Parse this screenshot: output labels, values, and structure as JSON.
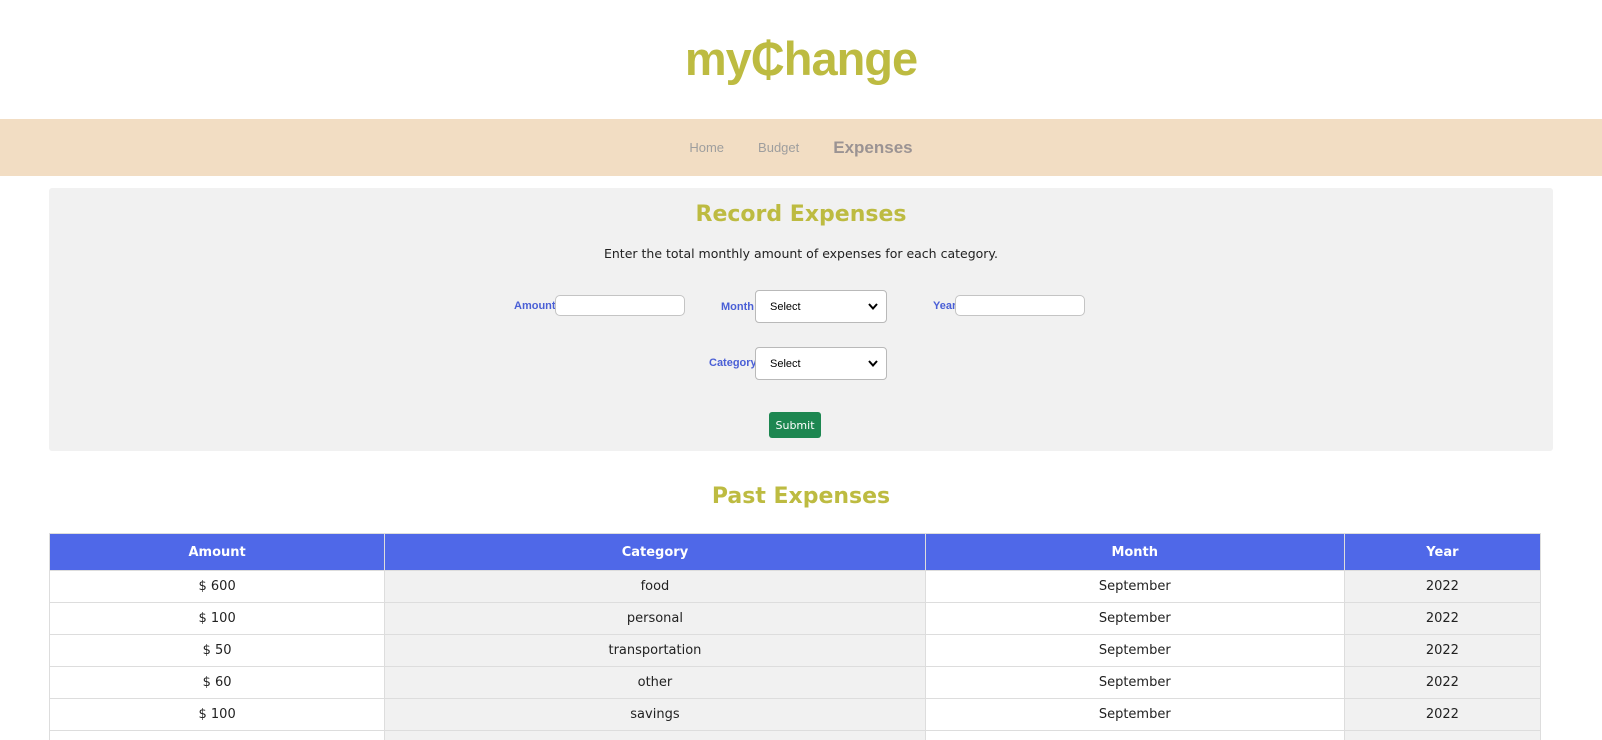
{
  "app": {
    "logo": "my₵hange"
  },
  "nav": {
    "items": [
      {
        "label": "Home"
      },
      {
        "label": "Budget"
      },
      {
        "label": "Expenses"
      }
    ],
    "active": "Expenses"
  },
  "record": {
    "title": "Record Expenses",
    "description": "Enter the total monthly amount of expenses for each category.",
    "amount_label": "Amount",
    "amount_value": "",
    "month_label": "Month",
    "month_selected": "Select",
    "year_label": "Year",
    "year_value": "",
    "category_label": "Category",
    "category_selected": "Select",
    "submit_label": "Submit"
  },
  "past": {
    "title": "Past Expenses",
    "columns": [
      "Amount",
      "Category",
      "Month",
      "Year"
    ],
    "rows": [
      [
        "$ 600",
        "food",
        "September",
        "2022"
      ],
      [
        "$ 100",
        "personal",
        "September",
        "2022"
      ],
      [
        "$ 50",
        "transportation",
        "September",
        "2022"
      ],
      [
        "$ 60",
        "other",
        "September",
        "2022"
      ],
      [
        "$ 100",
        "savings",
        "September",
        "2022"
      ],
      [
        "",
        "",
        "",
        ""
      ]
    ]
  },
  "colors": {
    "brand": "#bdbb41",
    "nav_bg": "#f2ddc3",
    "label_blue": "#4a5fd6",
    "table_header": "#4f68e8",
    "submit_green": "#1d8751"
  }
}
